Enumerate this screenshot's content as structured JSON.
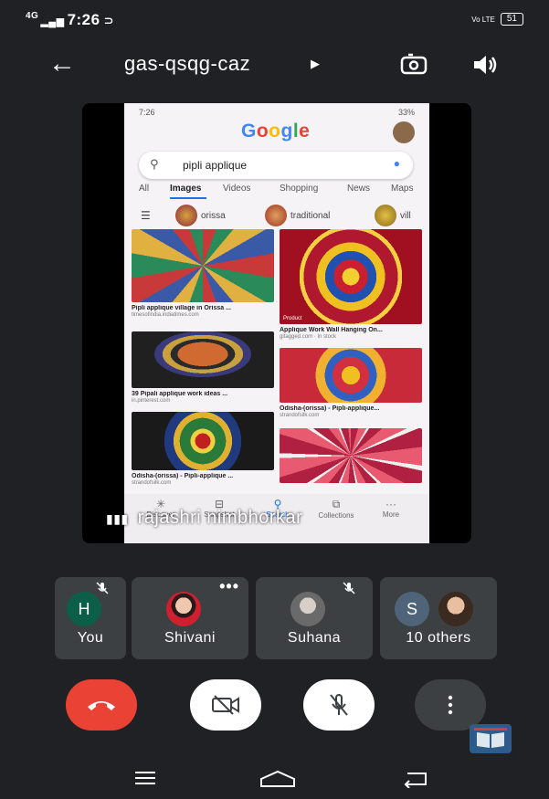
{
  "status_bar": {
    "signal": "4G",
    "time": "7:26",
    "volte": "Vo LTE",
    "battery": "51"
  },
  "header": {
    "meeting_code": "gas-qsqg-caz"
  },
  "shared_screen": {
    "phone_status_time": "7:26",
    "phone_status_right": "33%",
    "search_query": "pipli applique",
    "tabs": [
      "All",
      "Images",
      "Videos",
      "Shopping",
      "News",
      "Maps"
    ],
    "chips": [
      "orissa",
      "traditional",
      "vill"
    ],
    "results": [
      {
        "caption": "Pipli applique village in Orissa ...",
        "source": "timesofindia.indiatimes.com"
      },
      {
        "caption": "Applique Work Wall Hanging On...",
        "source": "gitagged.com · In stock"
      },
      {
        "caption": "39 Pipali applique work ideas ...",
        "source": "in.pinterest.com"
      },
      {
        "caption": "Odisha-(orissa) - Pipli-applique...",
        "source": "strandofsilk.com"
      },
      {
        "caption": "Odisha-(orissa) - Pipli-applique ...",
        "source": "strandofsilk.com"
      }
    ],
    "product_tag": "Product",
    "bottom_nav": [
      "Discover",
      "Snapshot",
      "Search",
      "Collections",
      "More"
    ],
    "presenter_name": "rajashri nimbhorkar"
  },
  "participants": [
    {
      "initial": "H",
      "name": "You",
      "color": "#0b5f49"
    },
    {
      "name": "Shivani"
    },
    {
      "name": "Suhana"
    },
    {
      "initial": "S",
      "name": "10 others",
      "color": "#4f6479"
    }
  ],
  "colors": {
    "end_call": "#ea4335",
    "tile": "#3c4043",
    "background": "#202124"
  }
}
